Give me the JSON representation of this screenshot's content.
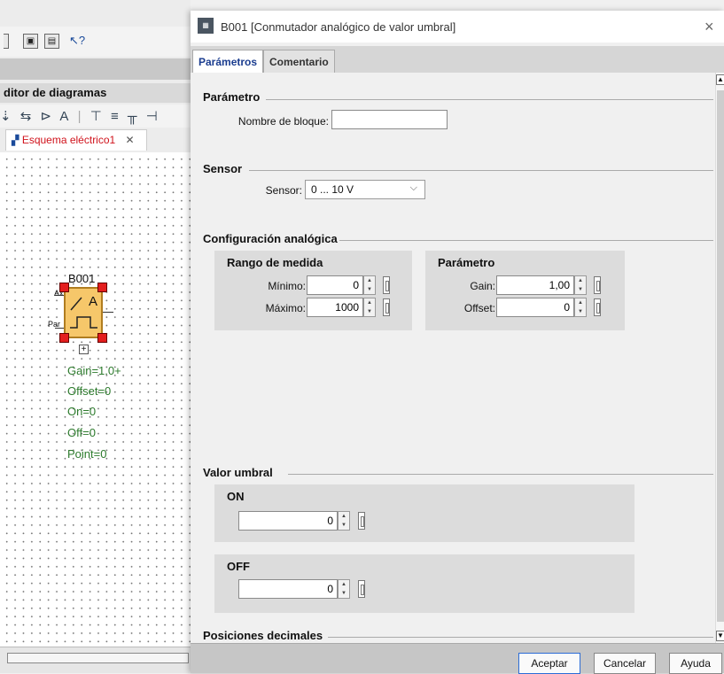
{
  "background_app": {
    "editor_title": "ditor de diagramas",
    "toolbar_glyphs": [
      "⇣",
      "⇆",
      "⊳",
      "A",
      "|",
      "⊤",
      "≡",
      "╥",
      "⊣"
    ],
    "document_tab": {
      "label": "Esquema eléctrico1",
      "close": "✕"
    },
    "block": {
      "name": "B001",
      "pin_ax": "Ax",
      "pin_par": "Par",
      "symbol": "A",
      "expand": "+",
      "params": [
        "Gain=1.0+",
        "Offset=0",
        "On=0",
        "Off=0",
        "Point=0"
      ]
    }
  },
  "dialog": {
    "title": "B001 [Conmutador analógico de valor umbral]",
    "icon": "logo-module-icon",
    "close_glyph": "×",
    "tabs": [
      {
        "label": "Parámetros",
        "active": true
      },
      {
        "label": "Comentario",
        "active": false
      }
    ],
    "parametro": {
      "heading": "Parámetro",
      "block_name_label": "Nombre de bloque:",
      "block_name_value": ""
    },
    "sensor": {
      "heading": "Sensor",
      "label": "Sensor:",
      "value": "0 ... 10 V"
    },
    "analog_config": {
      "heading": "Configuración analógica",
      "range": {
        "title": "Rango de medida",
        "min_label": "Mínimo:",
        "min_value": "0",
        "max_label": "Máximo:",
        "max_value": "1000"
      },
      "param": {
        "title": "Parámetro",
        "gain_label": "Gain:",
        "gain_value": "1,00",
        "offset_label": "Offset:",
        "offset_value": "0"
      }
    },
    "threshold": {
      "heading": "Valor umbral",
      "on_title": "ON",
      "on_value": "0",
      "off_title": "OFF",
      "off_value": "0"
    },
    "decimals_heading": "Posiciones decimales",
    "buttons": {
      "accept": "Aceptar",
      "cancel": "Cancelar",
      "help": "Ayuda"
    }
  }
}
